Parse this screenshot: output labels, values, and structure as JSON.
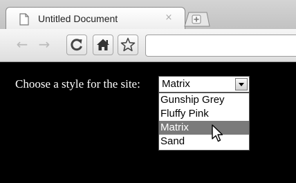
{
  "tab": {
    "title": "Untitled Document",
    "close_glyph": "×",
    "icon": "page-icon"
  },
  "toolbar": {
    "back_glyph": "←",
    "forward_glyph": "→",
    "icons": [
      "reload-icon",
      "home-icon",
      "star-icon"
    ],
    "address": ""
  },
  "page": {
    "label": "Choose a style for the site:",
    "select": {
      "selected": "Matrix",
      "options": [
        "Gunship Grey",
        "Fluffy Pink",
        "Matrix",
        "Sand"
      ],
      "highlighted_index": 2
    }
  }
}
